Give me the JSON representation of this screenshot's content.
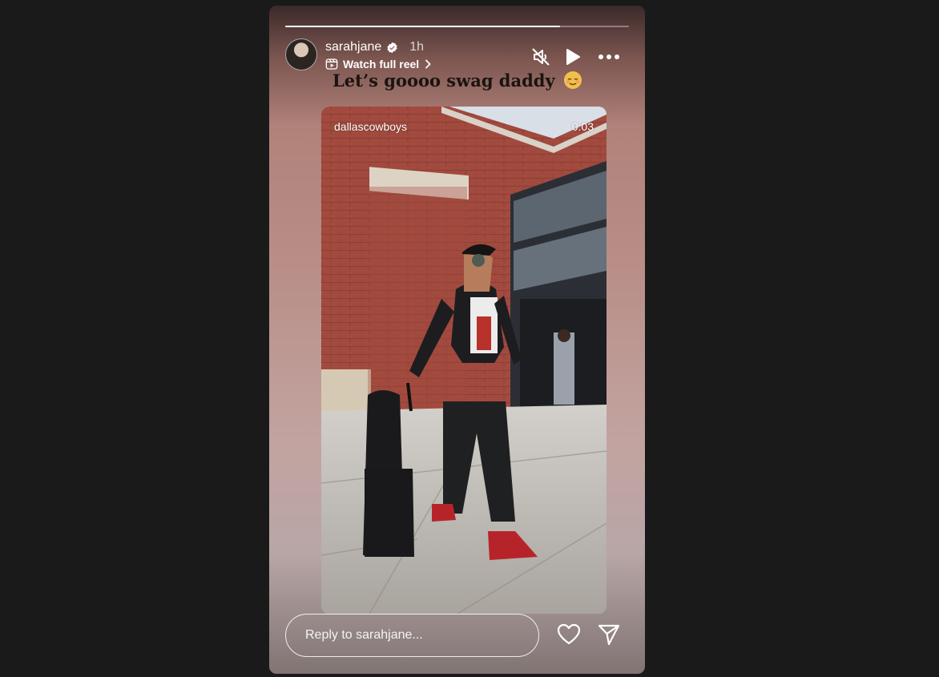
{
  "story": {
    "progress": 0.8,
    "user": {
      "username": "sarahjane",
      "verified": true,
      "time_ago": "1h",
      "avatar_icon": "profile-avatar"
    },
    "reel_link": {
      "label": "Watch full reel",
      "icon": "reels-icon",
      "chevron_icon": "chevron-right-icon"
    },
    "controls": {
      "mute_icon": "muted-speaker-icon",
      "play_icon": "play-icon",
      "more_icon": "more-dots-icon"
    },
    "caption": "Let’s goooo swag daddy",
    "caption_emoji": "relieved-face-emoji",
    "video": {
      "source": "dallascowboys",
      "timestamp": "0:03",
      "image": "man-with-luggage-walking-photo"
    },
    "reply": {
      "placeholder": "Reply to sarahjane..."
    },
    "actions": {
      "like_icon": "heart-icon",
      "share_icon": "send-icon"
    }
  },
  "colors": {
    "background": "#1a1a1a",
    "text": "#ffffff"
  }
}
